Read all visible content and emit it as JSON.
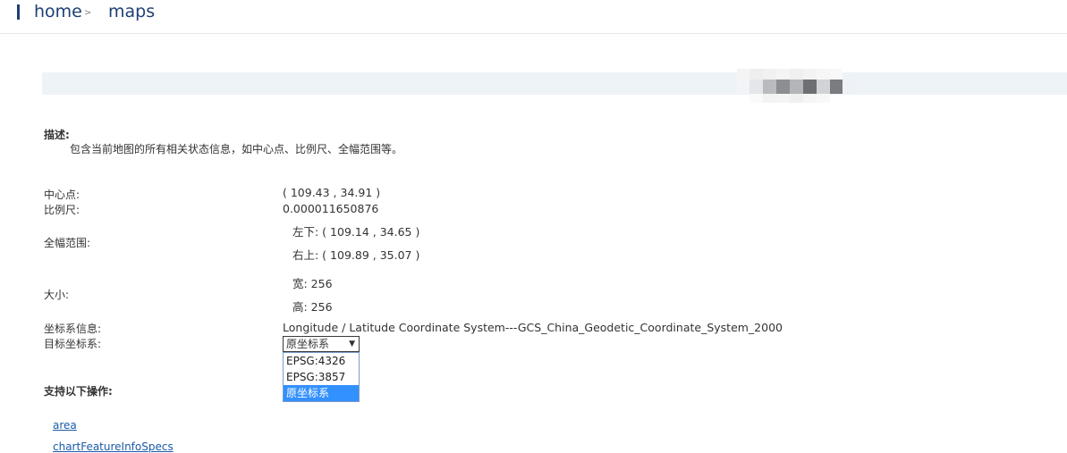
{
  "breadcrumb": {
    "home": "home",
    "separator": ">",
    "current": "maps"
  },
  "description": {
    "heading": "描述:",
    "text": "包含当前地图的所有相关状态信息，如中心点、比例尺、全幅范围等。"
  },
  "fields": {
    "center_label": "中心点:",
    "center_value": "( 109.43 , 34.91 )",
    "scale_label": "比例尺:",
    "scale_value": "0.000011650876",
    "bounds_label": "全幅范围:",
    "bounds_lower_left": "左下:  ( 109.14 , 34.65 )",
    "bounds_upper_right": "右上:  ( 109.89 , 35.07 )",
    "size_label": "大小:",
    "size_width": "宽:  256",
    "size_height": "高:  256",
    "crs_label": "坐标系信息:",
    "crs_value": "Longitude / Latitude Coordinate System---GCS_China_Geodetic_Coordinate_System_2000",
    "target_crs_label": "目标坐标系:"
  },
  "target_crs_select": {
    "value": "原坐标系",
    "options": [
      "EPSG:4326",
      "EPSG:3857",
      "原坐标系"
    ],
    "selected_index": 2
  },
  "operations": {
    "heading": "支持以下操作:",
    "links": [
      "area",
      "chartFeatureInfoSpecs"
    ]
  },
  "colors": {
    "accent": "#1e3f73",
    "link": "#1a5aa8",
    "banner": "#eef3f8",
    "selected_option": "#3390ff"
  }
}
